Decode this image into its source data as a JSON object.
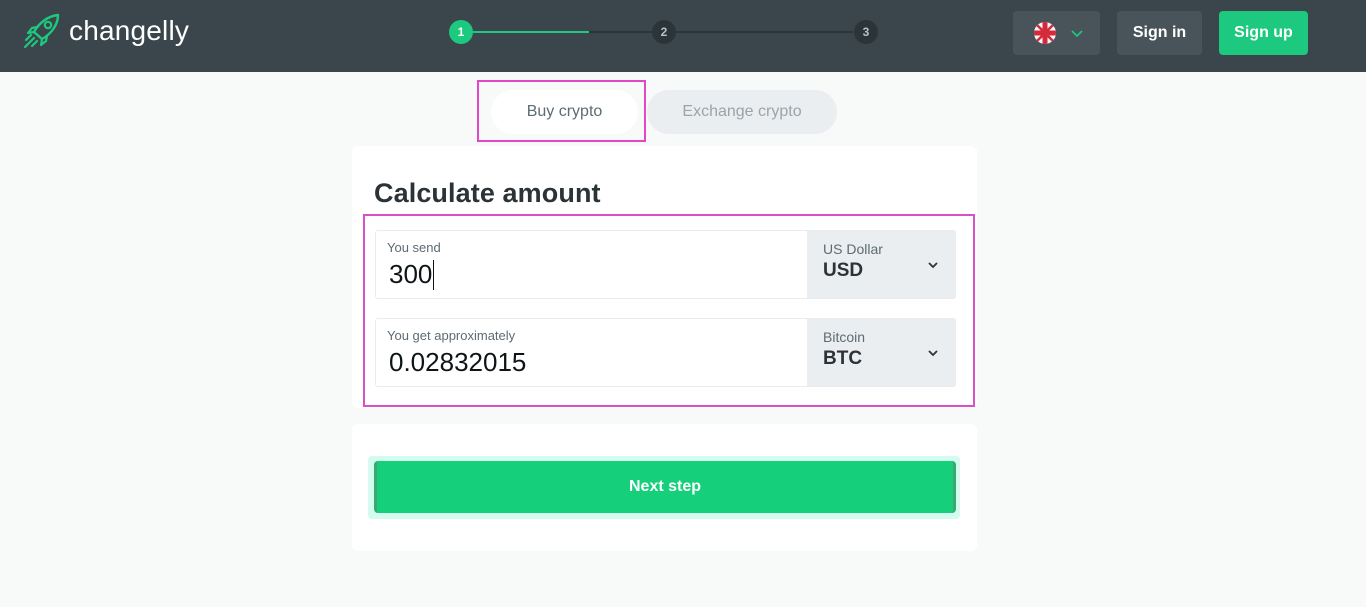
{
  "header": {
    "brand_name": "changelly",
    "steps": [
      "1",
      "2",
      "3"
    ],
    "active_step": 1,
    "language": {
      "flag": "uk-flag-icon",
      "chevron": "chevron-down-icon"
    },
    "signin_label": "Sign in",
    "signup_label": "Sign up"
  },
  "tabs": {
    "buy_label": "Buy crypto",
    "exchange_label": "Exchange crypto",
    "active": "buy"
  },
  "calculator": {
    "title": "Calculate amount",
    "send": {
      "label": "You send",
      "value": "300",
      "currency_name": "US Dollar",
      "currency_code": "USD"
    },
    "get": {
      "label": "You get approximately",
      "value": "0.02832015",
      "currency_name": "Bitcoin",
      "currency_code": "BTC"
    }
  },
  "actions": {
    "next_label": "Next step"
  },
  "colors": {
    "header_bg": "#3b464c",
    "accent": "#1dc97e",
    "highlight": "#e247c8"
  }
}
